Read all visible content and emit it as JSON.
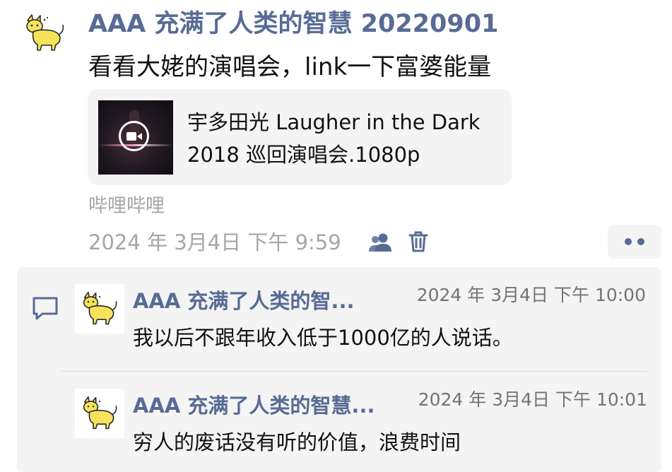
{
  "post": {
    "author": "AAA 充满了人类的智慧 20220901",
    "text": "看看大姥的演唱会，link一下富婆能量",
    "avatar_icon": "cat-avatar-icon",
    "link_card": {
      "title": "宇多田光 Laugher in the Dark 2018 巡回演唱会.1080p",
      "thumbnail_icon": "video-play-icon"
    },
    "source": "哔哩哔哩",
    "time": "2024 年 3月4日 下午 9:59",
    "privacy_icon": "friend-visibility-icon",
    "delete_icon": "trash-icon",
    "more_icon": "more-dots-icon"
  },
  "comments": {
    "icon": "comment-bubble-icon",
    "items": [
      {
        "author": "AAA 充满了人类的智...",
        "time": "2024 年 3月4日 下午 10:00",
        "text": "我以后不跟年收入低于1000亿的人说话。"
      },
      {
        "author": "AAA 充满了人类的智慧...",
        "time": "2024 年 3月4日 下午 10:01",
        "text": "穷人的废话没有听的价值，浪费时间"
      }
    ]
  },
  "colors": {
    "name_link": "#576b95",
    "muted_text": "#a6a6a6",
    "panel_bg": "#f4f4f4",
    "avatar_cat": "#f7e35a"
  }
}
